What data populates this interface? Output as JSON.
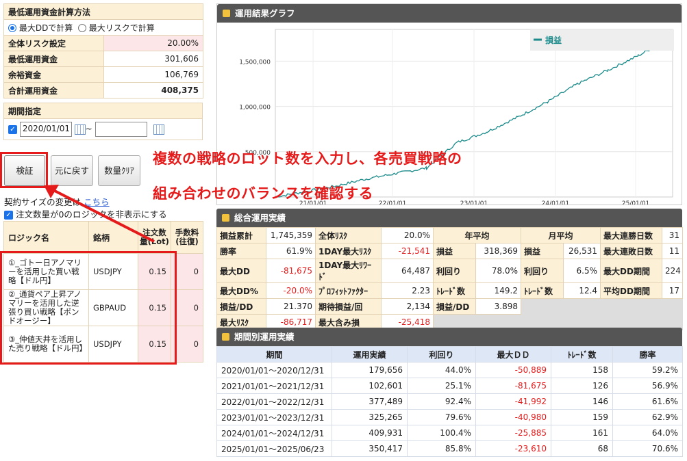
{
  "calc": {
    "title": "最低運用資金計算方法",
    "radio_dd": "最大DDで計算",
    "radio_risk": "最大リスクで計算",
    "rows": [
      {
        "label": "全体リスク設定",
        "value": "20.00%"
      },
      {
        "label": "最低運用資金",
        "value": "301,606"
      },
      {
        "label": "余裕資金",
        "value": "106,769"
      },
      {
        "label": "合計運用資金",
        "value": "408,375"
      }
    ]
  },
  "period": {
    "title": "期間指定",
    "start": "2020/01/01",
    "tilde": "~",
    "end": ""
  },
  "buttons": {
    "verify": "検証",
    "reset": "元に戻す",
    "qty_clear": "数量ｸﾘｱ"
  },
  "contract": {
    "text": "契約サイズの変更は",
    "link": "こちら"
  },
  "hide_zero": "注文数量が0のロジックを非表示にする",
  "logic_table": {
    "headers": [
      "ロジック名",
      "銘柄",
      "注文数量(Lot)",
      "手数料(往復)"
    ],
    "rows": [
      {
        "name": "①_ゴトー日アノマリーを活用した買い戦略【ドル円】",
        "symbol": "USDJPY",
        "qty": "0.15",
        "fee": "0"
      },
      {
        "name": "②_通貨ペア上昇アノマリーを活用した逆張り買い戦略【ポンドオージー】",
        "symbol": "GBPAUD",
        "qty": "0.15",
        "fee": "0"
      },
      {
        "name": "③_仲値天井を活用した売り戦略【ドル円】",
        "symbol": "USDJPY",
        "qty": "0.15",
        "fee": "0"
      }
    ]
  },
  "graph": {
    "title": "運用結果グラフ",
    "legend": "損益"
  },
  "chart_data": {
    "type": "line",
    "series": [
      {
        "name": "損益",
        "color": "#1a8a8a"
      }
    ],
    "x": [
      "2020/01",
      "2020/07",
      "2021/01",
      "2021/07",
      "2022/01",
      "2022/04",
      "2022/07",
      "2023/01",
      "2023/07",
      "2024/01",
      "2024/07",
      "2025/01",
      "2025/04",
      "2025/06"
    ],
    "y": [
      0,
      60000,
      120000,
      200000,
      260000,
      320000,
      600000,
      720000,
      880000,
      1050000,
      1250000,
      1400000,
      1560000,
      1745359
    ],
    "ytick_labels": [
      "1,500,000",
      "1,000,000",
      "500,000"
    ],
    "xtick_labels": [
      "21/01/01",
      "22/01/01",
      "23/01/01",
      "24/01/01",
      "25/01/01"
    ],
    "ylim": [
      0,
      1850000
    ],
    "grid": true,
    "legend_position": "top-right"
  },
  "overlay": {
    "line1": "複数の戦略のロット数を入力し、各売買戦略の",
    "line2": "組み合わせのバランスを確認する"
  },
  "summary": {
    "title": "総合運用実績",
    "colA": [
      {
        "label": "損益累計",
        "value": "1,745,359",
        "neg": false
      },
      {
        "label": "勝率",
        "value": "61.9%",
        "neg": false
      },
      {
        "label": "最大DD",
        "value": "-81,675",
        "neg": true
      },
      {
        "label": "最大DD%",
        "value": "-20.0%",
        "neg": true
      },
      {
        "label": "損益/DD",
        "value": "21.370",
        "neg": false
      },
      {
        "label": "最大ﾘｽｸ",
        "value": "-86,717",
        "neg": true
      }
    ],
    "colB": [
      {
        "label": "全体ﾘｽｸ",
        "value": "20.0%",
        "neg": false
      },
      {
        "label": "1DAY最大ﾘｽｸ",
        "value": "-21,541",
        "neg": true
      },
      {
        "label": "1DAY最大ﾘﾜｰﾄﾞ",
        "value": "64,487",
        "neg": false
      },
      {
        "label": "ﾌﾟﾛﾌｨｯﾄﾌｧｸﾀｰ",
        "value": "2.23",
        "neg": false
      },
      {
        "label": "期待損益/回",
        "value": "2,134",
        "neg": false
      },
      {
        "label": "最大含み損",
        "value": "-25,418",
        "neg": true
      }
    ],
    "yearly_title": "年平均",
    "yearly": [
      {
        "label": "損益",
        "value": "318,369"
      },
      {
        "label": "利回り",
        "value": "78.0%"
      },
      {
        "label": "ﾄﾚｰﾄﾞ数",
        "value": "149.2"
      },
      {
        "label": "損益/DD",
        "value": "3.898"
      }
    ],
    "monthly_title": "月平均",
    "monthly": [
      {
        "label": "損益",
        "value": "26,531"
      },
      {
        "label": "利回り",
        "value": "6.5%"
      },
      {
        "label": "ﾄﾚｰﾄﾞ数",
        "value": "12.4"
      }
    ],
    "colE": [
      {
        "label": "最大連勝日数",
        "value": "31"
      },
      {
        "label": "最大連敗日数",
        "value": "11"
      },
      {
        "label": "最大DD期間",
        "value": "224"
      },
      {
        "label": "平均DD期間",
        "value": "17"
      }
    ]
  },
  "period_table": {
    "title": "期間別運用実績",
    "headers": [
      "期間",
      "運用実績",
      "利回り",
      "最大ＤＤ",
      "ﾄﾚｰﾄﾞ数",
      "勝率"
    ],
    "rows": [
      [
        "2020/01/01～2020/12/31",
        "179,656",
        "44.0%",
        "-50,889",
        "158",
        "59.2%"
      ],
      [
        "2021/01/01～2021/12/31",
        "102,601",
        "25.1%",
        "-81,675",
        "126",
        "56.9%"
      ],
      [
        "2022/01/01～2022/12/31",
        "377,489",
        "92.4%",
        "-41,992",
        "146",
        "61.6%"
      ],
      [
        "2023/01/01～2023/12/31",
        "325,265",
        "79.6%",
        "-40,980",
        "159",
        "62.9%"
      ],
      [
        "2024/01/01～2024/12/31",
        "409,931",
        "100.4%",
        "-25,885",
        "161",
        "64.0%"
      ],
      [
        "2025/01/01～2025/06/23",
        "350,417",
        "85.8%",
        "-23,610",
        "68",
        "70.6%"
      ]
    ]
  }
}
